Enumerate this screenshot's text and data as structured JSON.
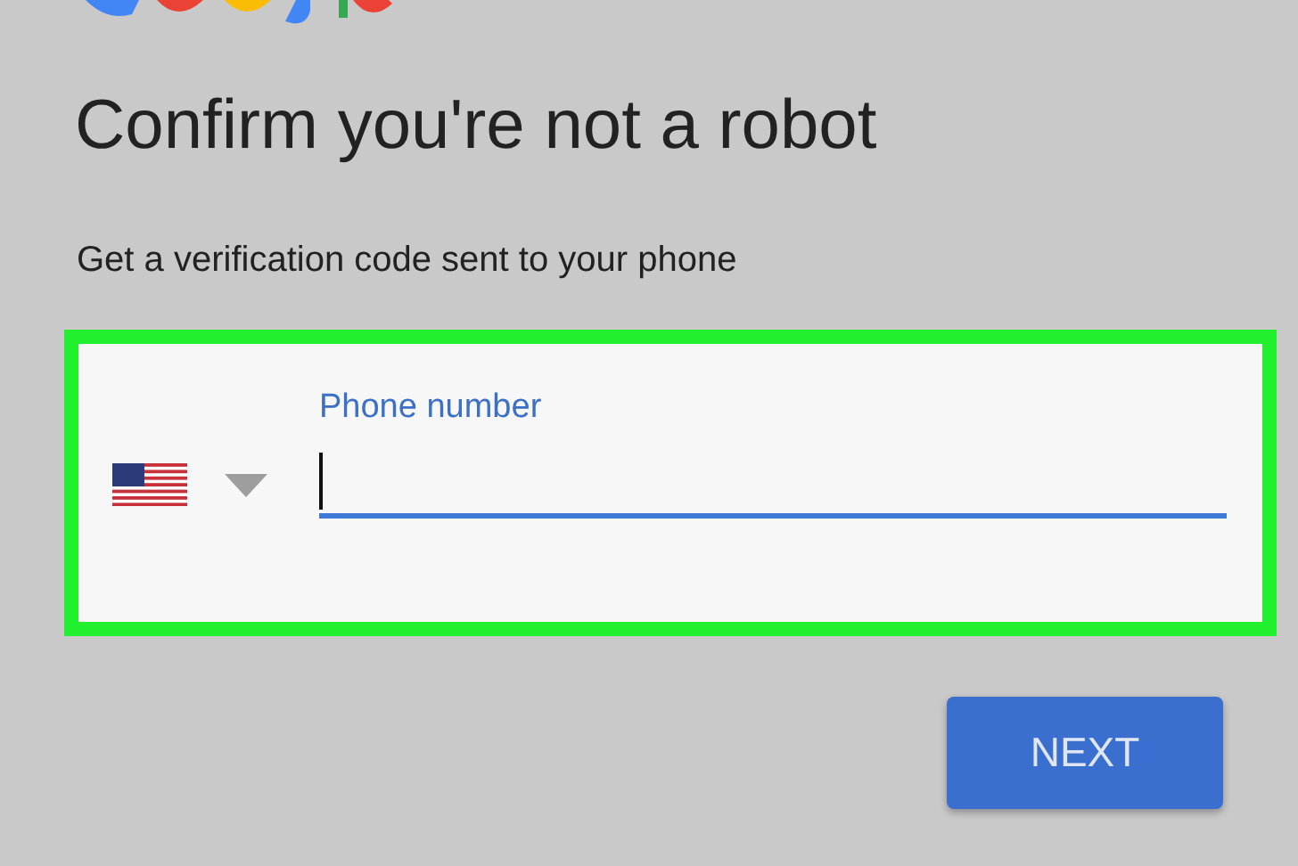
{
  "title": "Confirm you're not a robot",
  "subtitle": "Get a verification code sent to your phone",
  "phone_field": {
    "label": "Phone number",
    "focused": true
  },
  "buttons": [
    "NEXT"
  ]
}
